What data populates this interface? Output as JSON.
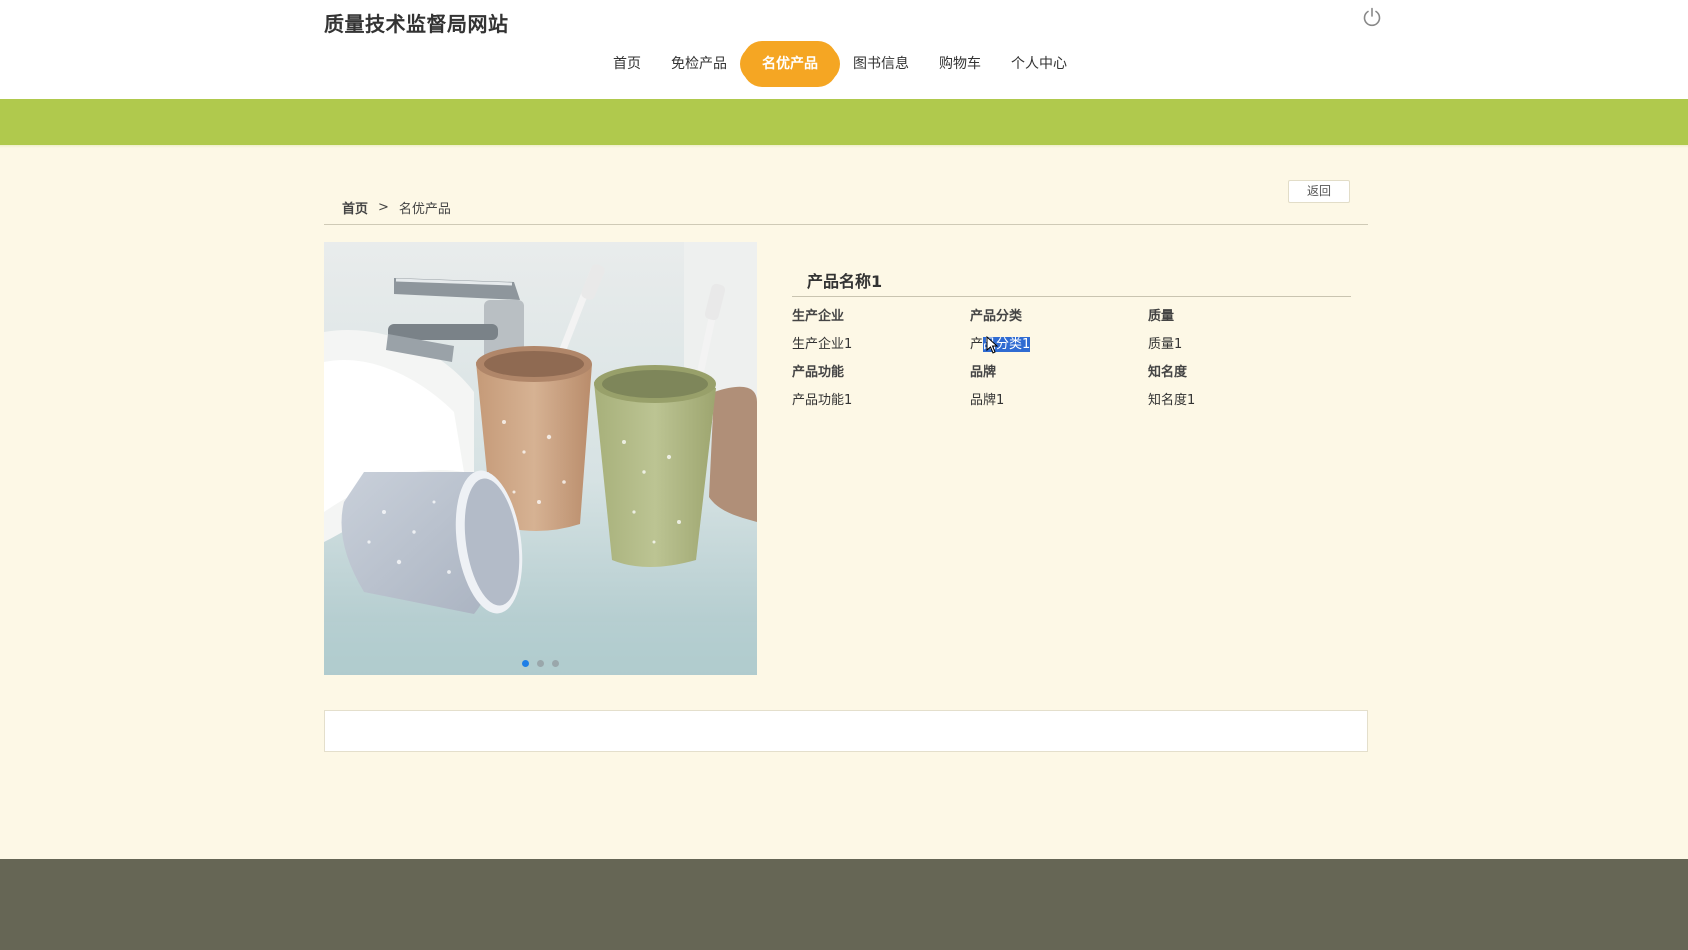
{
  "header": {
    "site_title": "质量技术监督局网站",
    "nav": [
      {
        "label": "首页",
        "active": false
      },
      {
        "label": "免检产品",
        "active": false
      },
      {
        "label": "名优产品",
        "active": true
      },
      {
        "label": "图书信息",
        "active": false
      },
      {
        "label": "购物车",
        "active": false
      },
      {
        "label": "个人中心",
        "active": false
      }
    ],
    "power_icon": "power-icon"
  },
  "breadcrumb": {
    "home": "首页",
    "separator": ">",
    "current": "名优产品"
  },
  "back_label": "返回",
  "product": {
    "name": "产品名称1",
    "carousel": {
      "count": 3,
      "active_index": 0
    },
    "fields": [
      {
        "label": "生产企业",
        "value": "生产企业1"
      },
      {
        "label": "产品分类",
        "value_prefix": "产",
        "value_selected": "品分类1"
      },
      {
        "label": "质量",
        "value": "质量1"
      },
      {
        "label": "产品功能",
        "value": "产品功能1"
      },
      {
        "label": "品牌",
        "value": "品牌1"
      },
      {
        "label": "知名度",
        "value": "知名度1"
      }
    ]
  },
  "colors": {
    "accent_orange": "#f5a623",
    "band_green": "#b0c94d",
    "page_bg": "#fdf8e6",
    "footer": "#666655",
    "selection": "#2f6bd2",
    "carousel_active": "#1e7ee6"
  }
}
